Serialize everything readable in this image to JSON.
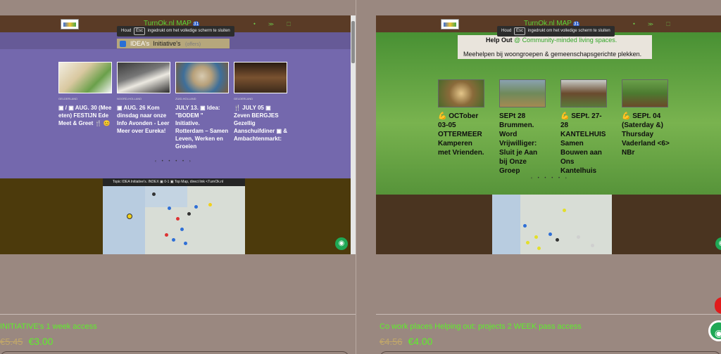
{
  "left_panel": {
    "brand": "TurnOk.nl MAP",
    "brand_badge": "31",
    "tooltip": {
      "prefix": "Houd",
      "key": "Esc",
      "suffix": "ingedrukt om het volledige scherm te sluiten"
    },
    "idea_title": {
      "part1": "IDEA's",
      "part2": "Initiative's",
      "part3": "(offers)"
    },
    "cards": [
      {
        "meta": "GELDERLAND",
        "title": "▣ / ▣ AUG. 30 (Mee eten) FESTIJN Ede Meet & Greet 🍴 😊"
      },
      {
        "meta": "NOORD-HOLLAND",
        "title": "▣ AUG. 26 Kom dinsdag naar onze Info Avonden - Leer Meer over Eureka!"
      },
      {
        "meta": "ZUID-HOLLAND",
        "title": "JULY 13. ▣ Idea: \"BODEM \" Initiative. Rotterdam – Samen Leven, Werken en Groeien"
      },
      {
        "meta": "GELDERLAND",
        "title": "🍴 JULY 05 ▣ Zeven BERGJES Gezellig Aanschuifdiner ▣ & Ambachtenmarkt:"
      }
    ],
    "map_title": "Topic IDEA Initiative's. INDEX ▣ 0-1 ▣ Top Map, direct link <TurnOk.nl",
    "whatsapp": "◉"
  },
  "right_panel": {
    "brand": "TurnOk.nl MAP",
    "brand_badge": "31",
    "tooltip": {
      "prefix": "Houd",
      "key": "Esc",
      "suffix": "ingedrukt om het volledige scherm te sluiten"
    },
    "help_title": "Help Out",
    "help_at": "@",
    "help_link": "Community-minded living spaces.",
    "help_sub": "Meehelpen bij woongroepen & gemeenschapsgerichte plekken.",
    "cards": [
      {
        "title": "💪 OCTober 03-05 OTTERMEER Kamperen met Vrienden."
      },
      {
        "title": "SEPt 28 Brummen. Word Vrijwilliger: Sluit je Aan bij Onze Groep"
      },
      {
        "title": "💪 SEPt. 27-28 KANTELHUIS Samen Bouwen aan Ons Kantelhuis"
      },
      {
        "title": "💪 SEPt. 04 (Saterday &) Thursday Vaderland <6> NBr"
      }
    ]
  },
  "products": [
    {
      "title": "INITIATIVE's 1 week access",
      "old_price": "€5.45",
      "price": "€3.00"
    },
    {
      "title": "Co work places Helping out: projects 2 WEEK pass access",
      "old_price": "€4.56",
      "price": "€4.00"
    }
  ],
  "icons": {
    "pager": "‹ • • • •  ›",
    "top_icons": "⬩ ≫ ⬚"
  }
}
